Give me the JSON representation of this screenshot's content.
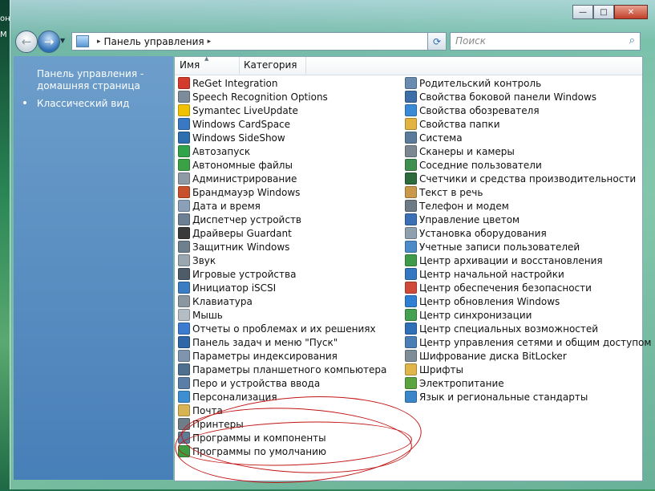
{
  "desktop": {
    "left_fragments": [
      "он",
      "М"
    ]
  },
  "window": {
    "caption_buttons": [
      "—",
      "□",
      "✕"
    ],
    "back_glyph": "←",
    "forward_glyph": "→",
    "address": "Панель управления",
    "address_arrow": "▸",
    "refresh_glyph": "⟳",
    "search_placeholder": "Поиск",
    "search_glyph": "⌕"
  },
  "leftpane": {
    "home_link": "Панель управления - домашняя страница",
    "classic_view": "Классический вид"
  },
  "columns": {
    "name": "Имя",
    "category": "Категория"
  },
  "colors": {
    "accent": "#477fb8",
    "annotation": "#c21414"
  },
  "items_col1": [
    {
      "label": "ReGet Integration",
      "icon": "reget-icon",
      "color": "#d33b2c"
    },
    {
      "label": "Speech Recognition Options",
      "icon": "microphone-icon",
      "color": "#7d8c9a"
    },
    {
      "label": "Symantec LiveUpdate",
      "icon": "symantec-icon",
      "color": "#f2c200"
    },
    {
      "label": "Windows CardSpace",
      "icon": "cardspace-icon",
      "color": "#3b78c4"
    },
    {
      "label": "Windows SideShow",
      "icon": "sideshow-icon",
      "color": "#2f6fb0"
    },
    {
      "label": "Автозапуск",
      "icon": "autoplay-icon",
      "color": "#2fa44a"
    },
    {
      "label": "Автономные файлы",
      "icon": "offline-files-icon",
      "color": "#3aa245"
    },
    {
      "label": "Администрирование",
      "icon": "admin-tools-icon",
      "color": "#8e9aa6"
    },
    {
      "label": "Брандмауэр Windows",
      "icon": "firewall-icon",
      "color": "#c8502c"
    },
    {
      "label": "Дата и время",
      "icon": "clock-icon",
      "color": "#8aa0b8"
    },
    {
      "label": "Диспетчер устройств",
      "icon": "device-manager-icon",
      "color": "#6c7f93"
    },
    {
      "label": "Драйверы Guardant",
      "icon": "guardant-icon",
      "color": "#3a3a3a"
    },
    {
      "label": "Защитник Windows",
      "icon": "defender-icon",
      "color": "#6e7f8e"
    },
    {
      "label": "Звук",
      "icon": "speaker-icon",
      "color": "#9aa6b0"
    },
    {
      "label": "Игровые устройства",
      "icon": "gamepad-icon",
      "color": "#4d5c68"
    },
    {
      "label": "Инициатор iSCSI",
      "icon": "globe-icon",
      "color": "#3b7cc2"
    },
    {
      "label": "Клавиатура",
      "icon": "keyboard-icon",
      "color": "#8a96a0"
    },
    {
      "label": "Мышь",
      "icon": "mouse-icon",
      "color": "#b5bdc4"
    },
    {
      "label": "Отчеты о проблемах и их решениях",
      "icon": "problem-reports-icon",
      "color": "#3d7bd0"
    },
    {
      "label": "Панель задач и меню \"Пуск\"",
      "icon": "taskbar-icon",
      "color": "#2f66a8"
    },
    {
      "label": "Параметры индексирования",
      "icon": "indexing-icon",
      "color": "#7f95ad"
    },
    {
      "label": "Параметры планшетного компьютера",
      "icon": "tablet-icon",
      "color": "#4f6f8f"
    },
    {
      "label": "Перо и устройства ввода",
      "icon": "pen-icon",
      "color": "#5a7ea6"
    },
    {
      "label": "Персонализация",
      "icon": "personalization-icon",
      "color": "#3d8fd1"
    },
    {
      "label": "Почта",
      "icon": "mail-icon",
      "color": "#d8b352"
    },
    {
      "label": "Принтеры",
      "icon": "printer-icon",
      "color": "#6f7d88"
    },
    {
      "label": "Программы и компоненты",
      "icon": "programs-icon",
      "color": "#5f7b96"
    },
    {
      "label": "Программы по умолчанию",
      "icon": "default-programs-icon",
      "color": "#3c9d42"
    }
  ],
  "items_col2": [
    {
      "label": "Родительский контроль",
      "icon": "parental-controls-icon",
      "color": "#6a8bb0"
    },
    {
      "label": "Свойства боковой панели Windows",
      "icon": "sidebar-icon",
      "color": "#3d6ea8"
    },
    {
      "label": "Свойства обозревателя",
      "icon": "internet-options-icon",
      "color": "#3a8ad6"
    },
    {
      "label": "Свойства папки",
      "icon": "folder-options-icon",
      "color": "#e2b341"
    },
    {
      "label": "Система",
      "icon": "system-icon",
      "color": "#5c7b9a"
    },
    {
      "label": "Сканеры и камеры",
      "icon": "scanner-icon",
      "color": "#7c8891"
    },
    {
      "label": "Соседние пользователи",
      "icon": "people-near-me-icon",
      "color": "#3f8f4f"
    },
    {
      "label": "Счетчики и средства производительности",
      "icon": "performance-icon",
      "color": "#2d6a3c"
    },
    {
      "label": "Текст в речь",
      "icon": "text-to-speech-icon",
      "color": "#c9984a"
    },
    {
      "label": "Телефон и модем",
      "icon": "phone-icon",
      "color": "#6e7a84"
    },
    {
      "label": "Управление цветом",
      "icon": "color-management-icon",
      "color": "#3b6fb6"
    },
    {
      "label": "Установка оборудования",
      "icon": "add-hardware-icon",
      "color": "#8fa0ae"
    },
    {
      "label": "Учетные записи пользователей",
      "icon": "user-accounts-icon",
      "color": "#4c8ac8"
    },
    {
      "label": "Центр архивации и восстановления",
      "icon": "backup-icon",
      "color": "#3f9a4a"
    },
    {
      "label": "Центр начальной настройки",
      "icon": "welcome-center-icon",
      "color": "#3478c2"
    },
    {
      "label": "Центр обеспечения безопасности",
      "icon": "security-center-icon",
      "color": "#d04a3a"
    },
    {
      "label": "Центр обновления Windows",
      "icon": "windows-update-icon",
      "color": "#2f7fd3"
    },
    {
      "label": "Центр синхронизации",
      "icon": "sync-center-icon",
      "color": "#45a04f"
    },
    {
      "label": "Центр специальных возможностей",
      "icon": "ease-of-access-icon",
      "color": "#2f6fb6"
    },
    {
      "label": "Центр управления сетями и общим доступом",
      "icon": "network-center-icon",
      "color": "#4a7fb5"
    },
    {
      "label": "Шифрование диска BitLocker",
      "icon": "bitlocker-icon",
      "color": "#7f8d98"
    },
    {
      "label": "Шрифты",
      "icon": "fonts-icon",
      "color": "#e0b64a"
    },
    {
      "label": "Электропитание",
      "icon": "power-icon",
      "color": "#5aa33f"
    },
    {
      "label": "Язык и региональные стандарты",
      "icon": "region-icon",
      "color": "#3a86c8"
    }
  ]
}
